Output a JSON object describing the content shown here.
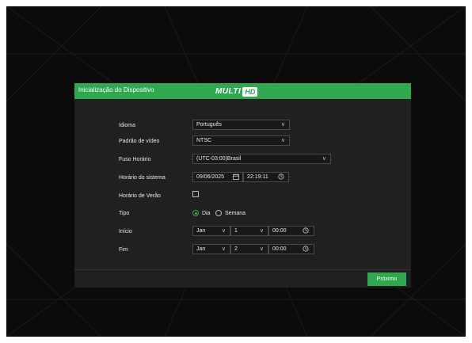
{
  "dialog": {
    "title": "Inicialização do Dispositivo",
    "logo_text": "MULTI",
    "logo_badge": "HD"
  },
  "form": {
    "language": {
      "label": "Idioma",
      "value": "Português"
    },
    "video_standard": {
      "label": "Padrão de vídeo",
      "value": "NTSC"
    },
    "timezone": {
      "label": "Fuso Horário",
      "value": "(UTC-03:00)Brasil"
    },
    "system_time": {
      "label": "Horário do sistema",
      "date": "09/06/2025",
      "time": "22:19:11"
    },
    "dst": {
      "label": "Horário de Verão",
      "checked": false
    },
    "type": {
      "label": "Tipo",
      "options": [
        "Dia",
        "Semana"
      ],
      "selected": "Dia"
    },
    "start": {
      "label": "Início",
      "month": "Jan",
      "day": "1",
      "time": "00:00"
    },
    "end": {
      "label": "Fim",
      "month": "Jan",
      "day": "2",
      "time": "00:00"
    }
  },
  "footer": {
    "next_label": "Próximo"
  },
  "colors": {
    "accent": "#2fa84f",
    "panel": "#202020",
    "background": "#0b0b0b"
  }
}
